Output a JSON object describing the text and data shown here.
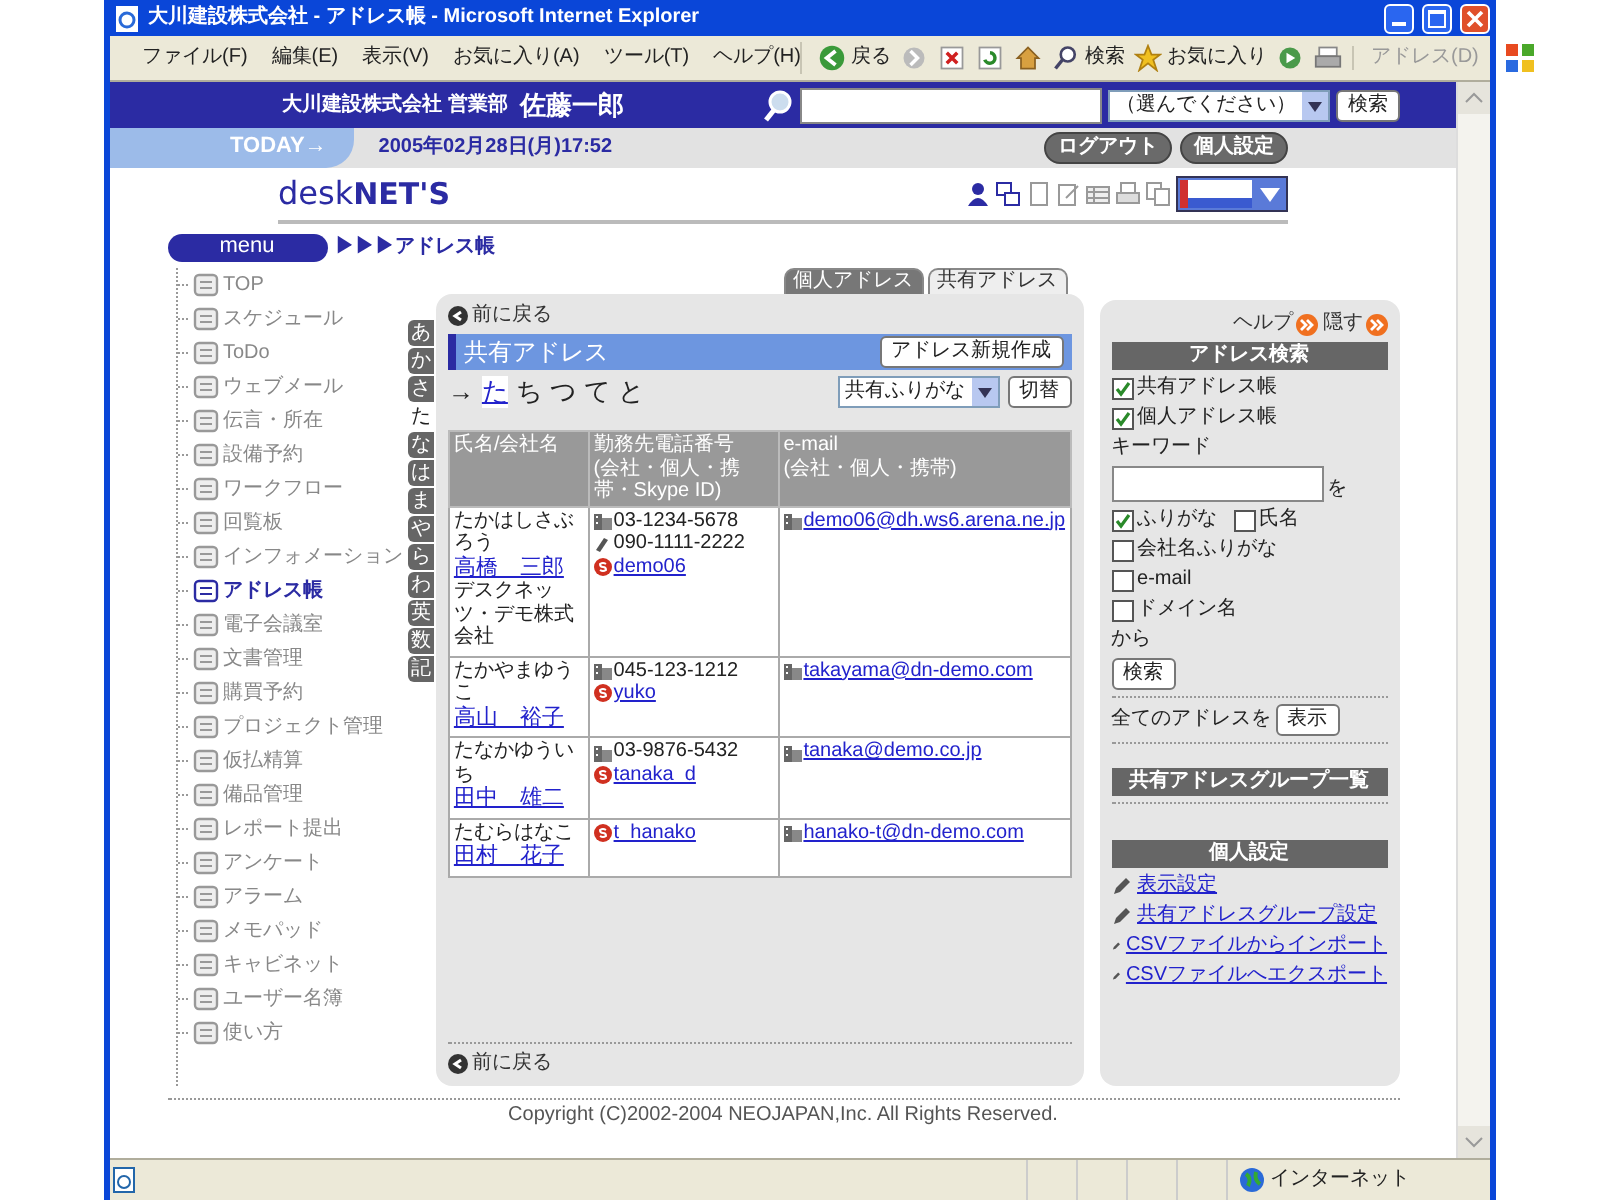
{
  "window": {
    "title": "大川建設株式会社 - アドレス帳 - Microsoft Internet Explorer"
  },
  "menubar": [
    "ファイル(F)",
    "編集(E)",
    "表示(V)",
    "お気に入り(A)",
    "ツール(T)",
    "ヘルプ(H)"
  ],
  "toolbar": [
    {
      "kind": "back",
      "label": "戻る"
    },
    {
      "kind": "forward"
    },
    {
      "kind": "stop"
    },
    {
      "kind": "refresh"
    },
    {
      "kind": "home"
    },
    {
      "kind": "search",
      "label": "検索"
    },
    {
      "kind": "favorites",
      "label": "お気に入り"
    },
    {
      "kind": "media"
    },
    {
      "kind": "print"
    }
  ],
  "address_label": "アドレス(D)",
  "header": {
    "company": "大川建設株式会社 営業部",
    "user": "佐藤一郎",
    "select": "（選んでください）",
    "button": "検索"
  },
  "today": {
    "label": "TODAY→",
    "datetime": "2005年02月28日(月)17:52",
    "buttons": [
      "ログアウト",
      "個人設定"
    ]
  },
  "logo": {
    "light": "desk",
    "bold": "NET'S"
  },
  "menu_label": "menu",
  "breadcrumb": {
    "arrows": "▶▶▶",
    "title": "アドレス帳"
  },
  "sidebar": {
    "items": [
      {
        "label": "TOP",
        "selected": false
      },
      {
        "label": "スケジュール",
        "selected": false
      },
      {
        "label": "ToDo",
        "selected": false
      },
      {
        "label": "ウェブメール",
        "selected": false
      },
      {
        "label": "伝言・所在",
        "selected": false
      },
      {
        "label": "設備予約",
        "selected": false
      },
      {
        "label": "ワークフロー",
        "selected": false
      },
      {
        "label": "回覧板",
        "selected": false
      },
      {
        "label": "インフォメーション",
        "selected": false
      },
      {
        "label": "アドレス帳",
        "selected": true
      },
      {
        "label": "電子会議室",
        "selected": false
      },
      {
        "label": "文書管理",
        "selected": false
      },
      {
        "label": "購買予約",
        "selected": false
      },
      {
        "label": "プロジェクト管理",
        "selected": false
      },
      {
        "label": "仮払精算",
        "selected": false
      },
      {
        "label": "備品管理",
        "selected": false
      },
      {
        "label": "レポート提出",
        "selected": false
      },
      {
        "label": "アンケート",
        "selected": false
      },
      {
        "label": "アラーム",
        "selected": false
      },
      {
        "label": "メモパッド",
        "selected": false
      },
      {
        "label": "キャビネット",
        "selected": false
      },
      {
        "label": "ユーザー名簿",
        "selected": false
      },
      {
        "label": "使い方",
        "selected": false
      }
    ]
  },
  "kana_tabs": [
    {
      "label": "あ",
      "selected": false
    },
    {
      "label": "か",
      "selected": false
    },
    {
      "label": "さ",
      "selected": false
    },
    {
      "label": "た",
      "selected": true
    },
    {
      "label": "な",
      "selected": false
    },
    {
      "label": "は",
      "selected": false
    },
    {
      "label": "ま",
      "selected": false
    },
    {
      "label": "や",
      "selected": false
    },
    {
      "label": "ら",
      "selected": false
    },
    {
      "label": "わ",
      "selected": false
    },
    {
      "label": "英",
      "selected": false
    },
    {
      "label": "数",
      "selected": false
    },
    {
      "label": "記",
      "selected": false
    }
  ],
  "tabs": [
    {
      "label": "個人アドレス",
      "selected": false
    },
    {
      "label": "共有アドレス",
      "selected": true
    }
  ],
  "main": {
    "back_link": "前に戻る",
    "title": "共有アドレス",
    "new_button": "アドレス新規作成",
    "kana_row": {
      "arrow": "→",
      "items": [
        {
          "label": "た",
          "selected": true
        },
        {
          "label": "ち",
          "selected": false
        },
        {
          "label": "つ",
          "selected": false
        },
        {
          "label": "て",
          "selected": false
        },
        {
          "label": "と",
          "selected": false
        }
      ]
    },
    "select": "共有ふりがな",
    "switch_button": "切替",
    "columns": [
      {
        "label": "氏名/会社名"
      },
      {
        "label": "勤務先電話番号",
        "note": "(会社・個人・携帯・Skype ID)"
      },
      {
        "label": "e-mail",
        "note": "(会社・個人・携帯)"
      }
    ],
    "rows": [
      {
        "kana": "たかはしさぶろう",
        "name": "高橋　三郎",
        "company": "デスクネッツ・デモ株式会社",
        "phones": [
          {
            "kind": "office",
            "text": "03-1234-5678"
          },
          {
            "kind": "mobile",
            "text": "090-1111-2222"
          },
          {
            "kind": "skype",
            "text": "demo06"
          }
        ],
        "emails": [
          {
            "kind": "office",
            "text": "demo06@dh.ws6.arena.ne.jp"
          }
        ]
      },
      {
        "kana": "たかやまゆうこ",
        "name": "高山　裕子",
        "phones": [
          {
            "kind": "office",
            "text": "045-123-1212"
          },
          {
            "kind": "skype",
            "text": "yuko"
          }
        ],
        "emails": [
          {
            "kind": "office",
            "text": "takayama@dn-demo.com"
          }
        ]
      },
      {
        "kana": "たなかゆういち",
        "name": "田中　雄二",
        "phones": [
          {
            "kind": "office",
            "text": "03-9876-5432"
          },
          {
            "kind": "skype",
            "text": "tanaka_d"
          }
        ],
        "emails": [
          {
            "kind": "office",
            "text": "tanaka@demo.co.jp"
          }
        ]
      },
      {
        "kana": "たむらはなこ",
        "name": "田村　花子",
        "phones": [
          {
            "kind": "skype",
            "text": "t_hanako"
          }
        ],
        "emails": [
          {
            "kind": "office",
            "text": "hanako-t@dn-demo.com"
          }
        ]
      }
    ],
    "footer_back_link": "前に戻る"
  },
  "right": {
    "help": "ヘルプ",
    "hide": "隠す",
    "search_title": "アドレス検索",
    "books": [
      {
        "label": "共有アドレス帳",
        "checked": true
      },
      {
        "label": "個人アドレス帳",
        "checked": true
      }
    ],
    "keyword_label": "キーワード",
    "keyword_suffix": "を",
    "option_rows": [
      {
        "items": [
          {
            "label": "ふりがな",
            "checked": true
          },
          {
            "label": "氏名",
            "checked": false
          }
        ]
      },
      {
        "items": [
          {
            "label": "会社名ふりがな",
            "checked": false
          }
        ]
      },
      {
        "items": [
          {
            "label": "e-mail",
            "checked": false
          }
        ]
      },
      {
        "items": [
          {
            "label": "ドメイン名",
            "checked": false
          }
        ]
      }
    ],
    "from_label": "から",
    "search_button": "検索",
    "show_all_label": "全てのアドレスを",
    "show_button": "表示",
    "group_title": "共有アドレスグループ一覧",
    "settings_title": "個人設定",
    "links": [
      "表示設定",
      "共有アドレスグループ設定",
      "CSVファイルからインポート",
      "CSVファイルへエクスポート"
    ]
  },
  "copyright": "Copyright (C)2002-2004 NEOJAPAN,Inc. All Rights Reserved.",
  "status": {
    "zone": "インターネット"
  }
}
